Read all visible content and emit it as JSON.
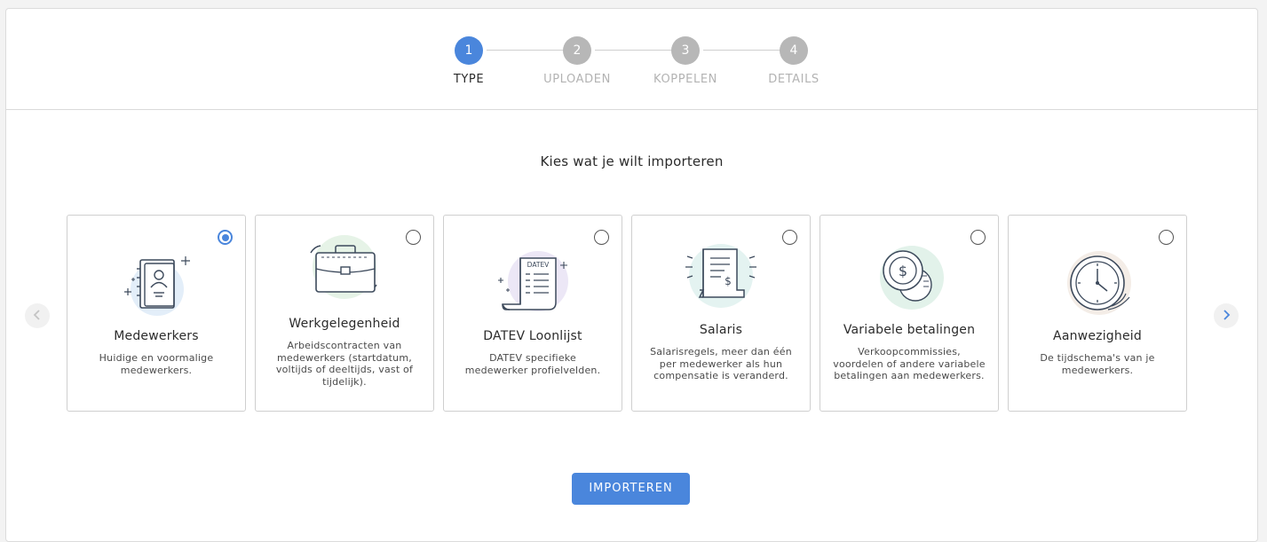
{
  "stepper": {
    "steps": [
      {
        "number": "1",
        "label": "TYPE",
        "active": true
      },
      {
        "number": "2",
        "label": "UPLOADEN",
        "active": false
      },
      {
        "number": "3",
        "label": "KOPPELEN",
        "active": false
      },
      {
        "number": "4",
        "label": "DETAILS",
        "active": false
      }
    ]
  },
  "heading": "Kies wat je wilt importeren",
  "cards": [
    {
      "title": "Medewerkers",
      "description": "Huidige en voormalige medewerkers.",
      "selected": true,
      "icon": "employee-book-icon"
    },
    {
      "title": "Werkgelegenheid",
      "description": "Arbeidscontracten van medewerkers (startdatum, voltijds of deeltijds, vast of tijdelijk).",
      "selected": false,
      "icon": "briefcase-icon"
    },
    {
      "title": "DATEV Loonlijst",
      "description": "DATEV specifieke medewerker profielvelden.",
      "selected": false,
      "icon": "datev-receipt-icon",
      "icon_text": "DATEV"
    },
    {
      "title": "Salaris",
      "description": "Salarisregels, meer dan één per medewerker als hun compensatie is veranderd.",
      "selected": false,
      "icon": "salary-receipt-icon"
    },
    {
      "title": "Variabele betalingen",
      "description": "Verkoopcommissies, voordelen of andere variabele betalingen aan medewerkers.",
      "selected": false,
      "icon": "coins-icon"
    },
    {
      "title": "Aanwezigheid",
      "description": "De tijdschema's van je medewerkers.",
      "selected": false,
      "icon": "clock-icon"
    }
  ],
  "buttons": {
    "import": "IMPORTEREN"
  },
  "colors": {
    "primary": "#4a86dc",
    "inactive_step": "#b7b7b7",
    "border": "#cfcfcf"
  }
}
